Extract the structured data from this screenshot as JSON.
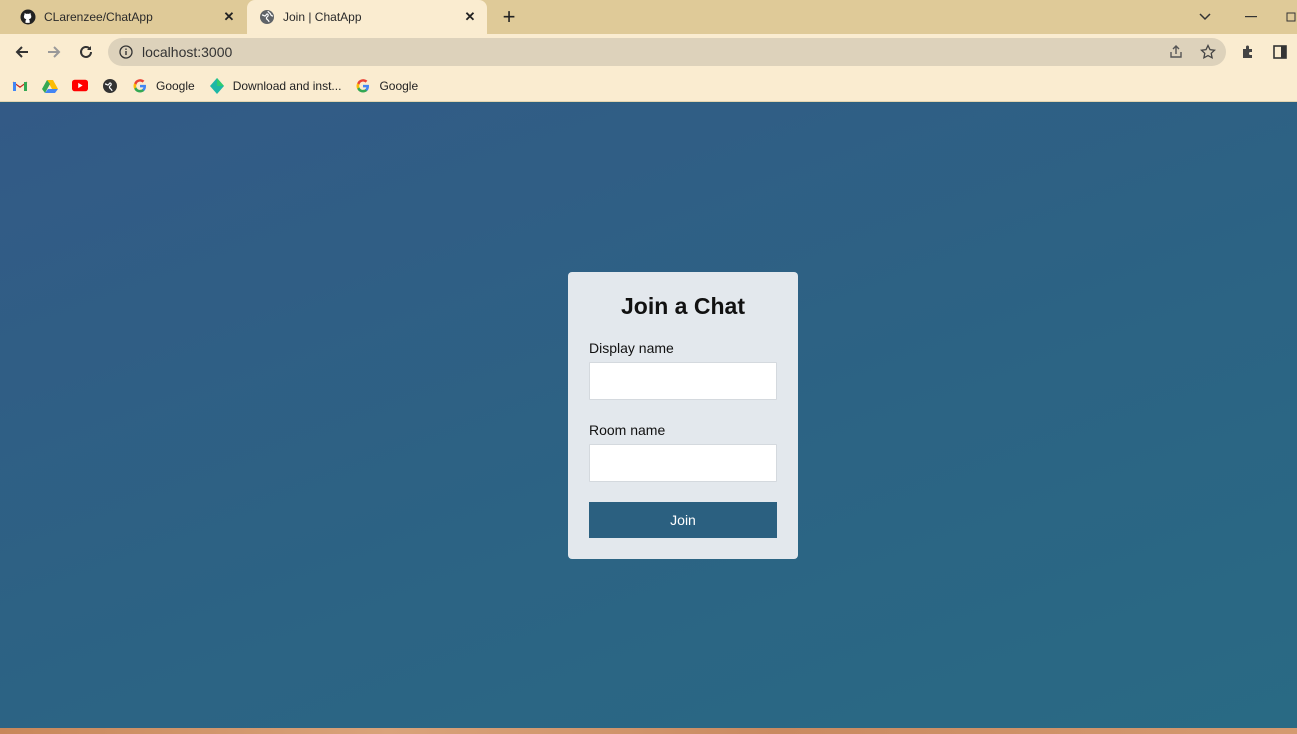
{
  "browser": {
    "tabs": [
      {
        "title": "CLarenzee/ChatApp",
        "icon": "github-icon",
        "active": false
      },
      {
        "title": "Join | ChatApp",
        "icon": "globe-icon",
        "active": true
      }
    ],
    "address": "localhost:3000",
    "bookmarks": [
      {
        "label": "",
        "icon": "gmail-icon"
      },
      {
        "label": "",
        "icon": "google-drive-icon"
      },
      {
        "label": "",
        "icon": "youtube-icon"
      },
      {
        "label": "",
        "icon": "globe-icon"
      },
      {
        "label": "Google",
        "icon": "google-icon"
      },
      {
        "label": "Download and inst...",
        "icon": "diamond-icon"
      },
      {
        "label": "Google",
        "icon": "google-icon"
      }
    ]
  },
  "card": {
    "title": "Join a Chat",
    "display_name_label": "Display name",
    "display_name_value": "",
    "room_name_label": "Room name",
    "room_name_value": "",
    "join_label": "Join"
  },
  "colors": {
    "accent": "#2b6080",
    "card_bg": "#e3e8ed",
    "tabbar_bg": "#dfca98",
    "toolbar_bg": "#faecd0"
  }
}
